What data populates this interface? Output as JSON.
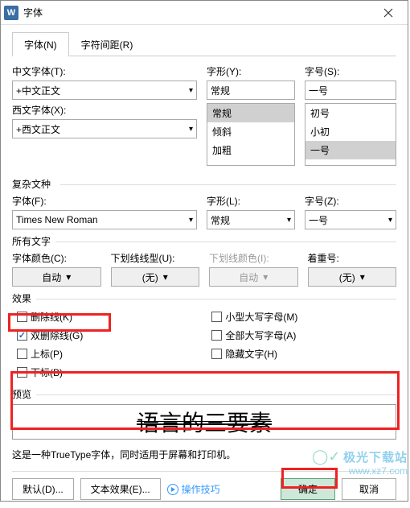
{
  "title": "字体",
  "tabs": {
    "font": "字体(N)",
    "spacing": "字符间距(R)"
  },
  "labels": {
    "chineseFont": "中文字体(T):",
    "style": "字形(Y):",
    "size": "字号(S):",
    "westernFont": "西文字体(X):",
    "complex": "复杂文种",
    "complexFont": "字体(F):",
    "complexStyle": "字形(L):",
    "complexSize": "字号(Z):",
    "allText": "所有文字",
    "fontColor": "字体颜色(C):",
    "underlineStyle": "下划线线型(U):",
    "underlineColor": "下划线颜色(I):",
    "emphasis": "着重号:",
    "effects": "效果",
    "preview": "预览"
  },
  "values": {
    "chineseFont": "+中文正文",
    "westernFont": "+西文正文",
    "styleSelected": "常规",
    "sizeSelected": "一号",
    "complexFont": "Times New Roman",
    "complexStyle": "常规",
    "complexSize": "一号",
    "fontColor": "自动",
    "underlineStyle": "(无)",
    "underlineColor": "自动",
    "emphasis": "(无)"
  },
  "styleOptions": [
    "常规",
    "倾斜",
    "加粗"
  ],
  "sizeOptions": [
    "初号",
    "小初",
    "一号"
  ],
  "effects": {
    "strikethrough": "删除线(K)",
    "doubleStrike": "双删除线(G)",
    "superscript": "上标(P)",
    "subscript": "下标(B)",
    "smallCaps": "小型大写字母(M)",
    "allCaps": "全部大写字母(A)",
    "hidden": "隐藏文字(H)"
  },
  "previewText": "语言的三要素",
  "desc": "这是一种TrueType字体，同时适用于屏幕和打印机。",
  "buttons": {
    "default": "默认(D)...",
    "textEffects": "文本效果(E)...",
    "tips": "操作技巧",
    "ok": "确定",
    "cancel": "取消"
  },
  "watermark": {
    "cn": "极光下载站",
    "url": "www.xz7.com"
  }
}
